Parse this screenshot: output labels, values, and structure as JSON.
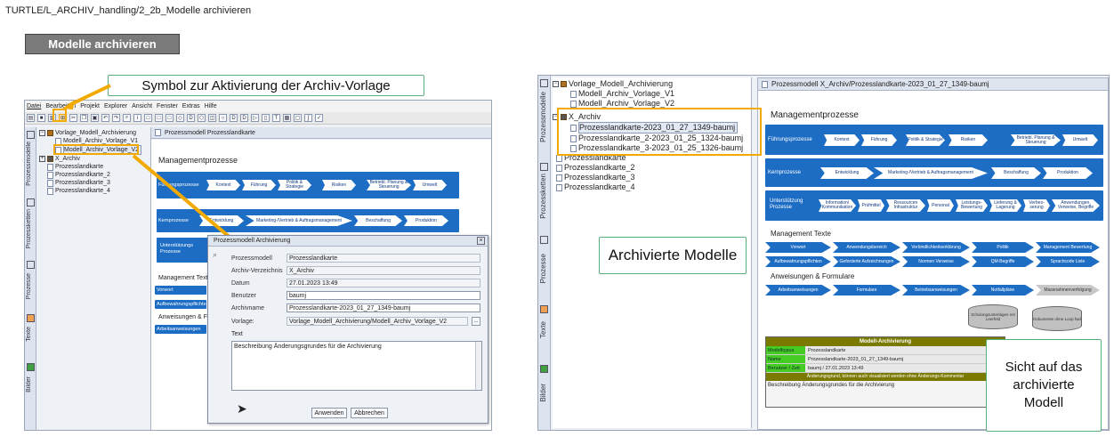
{
  "breadcrumb": "TURTLE/L_ARCHIV_handling/2_2b_Modelle archivieren",
  "title_button": "Modelle archivieren",
  "callouts": {
    "symbol": "Symbol zur Aktivierung der Archiv-Vorlage",
    "archived": "Archivierte Modelle",
    "view_line1": "Sicht auf das",
    "view_line2": "archivierte",
    "view_line3": "Modell"
  },
  "left_app": {
    "menu": [
      "Datei",
      "Bearbeiten",
      "Projekt",
      "Explorer",
      "Ansicht",
      "Fenster",
      "Extras",
      "Hilfe"
    ],
    "side_tabs": [
      "Prozessmodelle",
      "Prozessketten",
      "Prozesse",
      "Texte",
      "Bilder"
    ],
    "tree": [
      {
        "label": "Vorlage_Modell_Archivierung",
        "kind": "folder"
      },
      {
        "label": "Modell_Archiv_Vorlage_V1",
        "kind": "doc"
      },
      {
        "label": "Modell_Archiv_Vorlage_V2",
        "kind": "doc-selected"
      },
      {
        "label": "X_Archiv",
        "kind": "folder"
      },
      {
        "label": "Prozesslandkarte",
        "kind": "doc"
      },
      {
        "label": "Prozesslandkarte_2",
        "kind": "doc"
      },
      {
        "label": "Prozesslandkarte_3",
        "kind": "doc"
      },
      {
        "label": "Prozesslandkarte_4",
        "kind": "doc"
      }
    ],
    "panel_title": "Prozessmodell Prozesslandkarte",
    "section_title": "Managementprozesse",
    "rows": {
      "fuehrung": {
        "label": "Führungsprozesse",
        "items": [
          "Kontext",
          "Führung",
          "Politik & Strategie",
          "Risiken",
          "Betriebl. Planung & Steuerung",
          "Umwelt"
        ]
      },
      "kern": {
        "label": "Kernprozesse",
        "items": [
          "Entwicklung",
          "Marketing-/Vertrieb & Auftragsmanagement",
          "Beschaffung",
          "Produktion"
        ]
      },
      "unterstuetzung": {
        "label": "Unterstützungs Prozesse"
      }
    },
    "mgmt_texte": "Management Texte",
    "small_items": [
      "Vorwort",
      "Aufbewahrungspflichten"
    ],
    "anweisungen": "Anweisungen & For",
    "anweisungen_item": "Arbeitsanweisungen"
  },
  "dialog": {
    "title": "Prozessmodell Archivierung",
    "fields": [
      {
        "label": "Prozessmodell",
        "value": "Prozesslandkarte",
        "editable": false
      },
      {
        "label": "Archiv-Verzeichnis",
        "value": "X_Archiv",
        "editable": false
      },
      {
        "label": "Datum",
        "value": "27.01.2023 13:49",
        "editable": false
      },
      {
        "label": "Benutzer",
        "value": "baumj",
        "editable": true
      },
      {
        "label": "Archivname",
        "value": "Prozesslandkarte-2023_01_27_1349-baumj",
        "editable": true
      },
      {
        "label": "Vorlage:",
        "value": "Vorlage_Modell_Archivierung/Modell_Archiv_Vorlage_V2",
        "editable": false
      }
    ],
    "text_label": "Text",
    "text_value": "Beschreibung Änderungsgrundes für die Archivierung",
    "ok_label": "Anwenden",
    "cancel_label": "Abbrechen",
    "browse_label": "..."
  },
  "right_app": {
    "side_tabs": [
      "Prozessmodelle",
      "Prozessketten",
      "Prozesse",
      "Texte",
      "Bilder"
    ],
    "tree": [
      {
        "label": "Vorlage_Modell_Archivierung",
        "kind": "folder"
      },
      {
        "label": "Modell_Archiv_Vorlage_V1",
        "kind": "doc"
      },
      {
        "label": "Modell_Archiv_Vorlage_V2",
        "kind": "doc"
      },
      {
        "label": "X_Archiv",
        "kind": "folder"
      },
      {
        "label": "Prozesslandkarte-2023_01_27_1349-baumj",
        "kind": "doc-selected"
      },
      {
        "label": "Prozesslandkarte_2-2023_01_25_1324-baumj",
        "kind": "doc"
      },
      {
        "label": "Prozesslandkarte_3-2023_01_25_1326-baumj",
        "kind": "doc"
      },
      {
        "label": "Prozesslandkarte",
        "kind": "doc"
      },
      {
        "label": "Prozesslandkarte_2",
        "kind": "doc"
      },
      {
        "label": "Prozesslandkarte_3",
        "kind": "doc"
      },
      {
        "label": "Prozesslandkarte_4",
        "kind": "doc"
      }
    ],
    "panel_title": "Prozessmodell X_Archiv/Prozesslandkarte-2023_01_27_1349-baumj",
    "section_title": "Managementprozesse",
    "fuehrung": {
      "label": "Führungsprozesse",
      "items": [
        "Kontext",
        "Führung",
        "Politik & Strategie",
        "Risiken",
        "Betriebl. Planung & Steuerung",
        "Umwelt"
      ]
    },
    "kern": {
      "label": "Kernprozesse",
      "items": [
        "Entwicklung",
        "Marketing-/Vertrieb & Auftragsmanagement",
        "Beschaffung",
        "Produktion"
      ]
    },
    "unterstuetzung": {
      "label": "Unterstützung Prozesse",
      "items": [
        "Information/ Kommunikation",
        "Prüfmittel",
        "Ressourcen Infrastruktur",
        "Personal",
        "Leistungs-Bewertung",
        "Lieferung & Lagerung",
        "Verbes-serung",
        "Anwendungen, Verweise, Begriffe"
      ]
    },
    "mgmt_texte": "Management Texte",
    "texte_row1": [
      "Vorwort",
      "Anwendungsbereich",
      "Verbindlichkeitserklärung",
      "Politik",
      "Management Bewertung"
    ],
    "texte_row2": [
      "Aufbewahrungspflichten",
      "Geforderte Aufzeichnungen",
      "Normen Verweise",
      "QM-Begriffe",
      "Sprachcode Liste"
    ],
    "anweisungen": "Anweisungen & Formulare",
    "anweisungen_items": [
      "Arbeitsanweisungen",
      "Formulare",
      "Betriebsanweisungen",
      "Notfallpläne",
      "Massnahmenverfolgung"
    ],
    "cylinders": [
      "Schulungsunterlagen mit Leerfeld",
      "Dokumente ohne Loop fwd"
    ],
    "archive": {
      "title": "Modell-Archivierung",
      "rows": [
        {
          "k": "Modelltypus",
          "v": "Prozesslandkarte"
        },
        {
          "k": "Name Archivierung",
          "v": "Prozesslandkarte-2023_01_27_1349-baumj"
        },
        {
          "k": "Benutzer / Zeit",
          "v": "baumj / 27.01.2023 13:49"
        }
      ],
      "reason_head": "Änderungsgrund, können auch visualisiert werden ohne Änderungs-Kommentar",
      "reason": "Beschreibung Änderungsgrundes für die Archivierung"
    }
  }
}
